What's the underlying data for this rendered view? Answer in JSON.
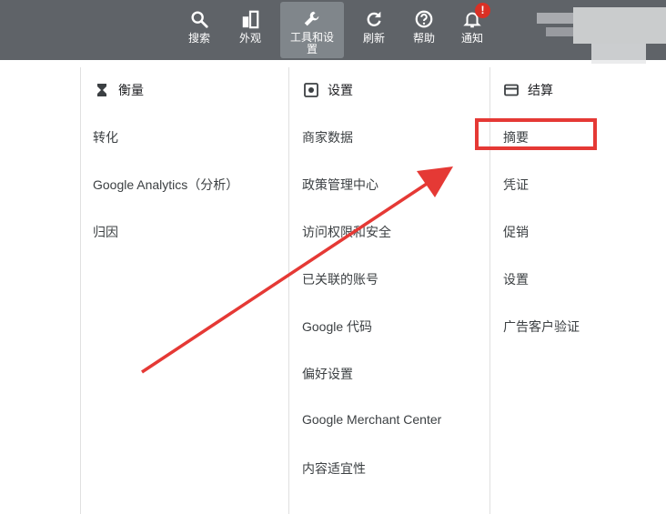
{
  "toolbar": {
    "buttons": [
      {
        "id": "search",
        "label": "搜索",
        "icon": "search-icon"
      },
      {
        "id": "appearance",
        "label": "外观",
        "icon": "appearance-icon"
      },
      {
        "id": "tools",
        "label": "工具和设\n置",
        "icon": "wrench-icon",
        "active": true
      },
      {
        "id": "refresh",
        "label": "刷新",
        "icon": "refresh-icon"
      },
      {
        "id": "help",
        "label": "帮助",
        "icon": "help-icon"
      },
      {
        "id": "notifications",
        "label": "通知",
        "icon": "bell-icon",
        "badge": "!"
      }
    ]
  },
  "columns": [
    {
      "heading": "衡量",
      "icon": "hourglass-icon",
      "items": [
        "转化",
        "Google Analytics（分析）",
        "归因"
      ]
    },
    {
      "heading": "设置",
      "icon": "settings-icon",
      "items": [
        "商家数据",
        "政策管理中心",
        "访问权限和安全",
        "已关联的账号",
        "Google 代码",
        "偏好设置",
        "Google Merchant Center",
        "内容适宜性"
      ]
    },
    {
      "heading": "结算",
      "icon": "credit-card-icon",
      "items": [
        "摘要",
        "凭证",
        "促销",
        "设置",
        "广告客户验证"
      ]
    }
  ],
  "annotation": {
    "highlighted_item": "摘要",
    "color": "#e53935"
  },
  "colors": {
    "toolbar_bg": "#5f6368",
    "active_bg": "#80868b",
    "badge": "#d93025"
  }
}
